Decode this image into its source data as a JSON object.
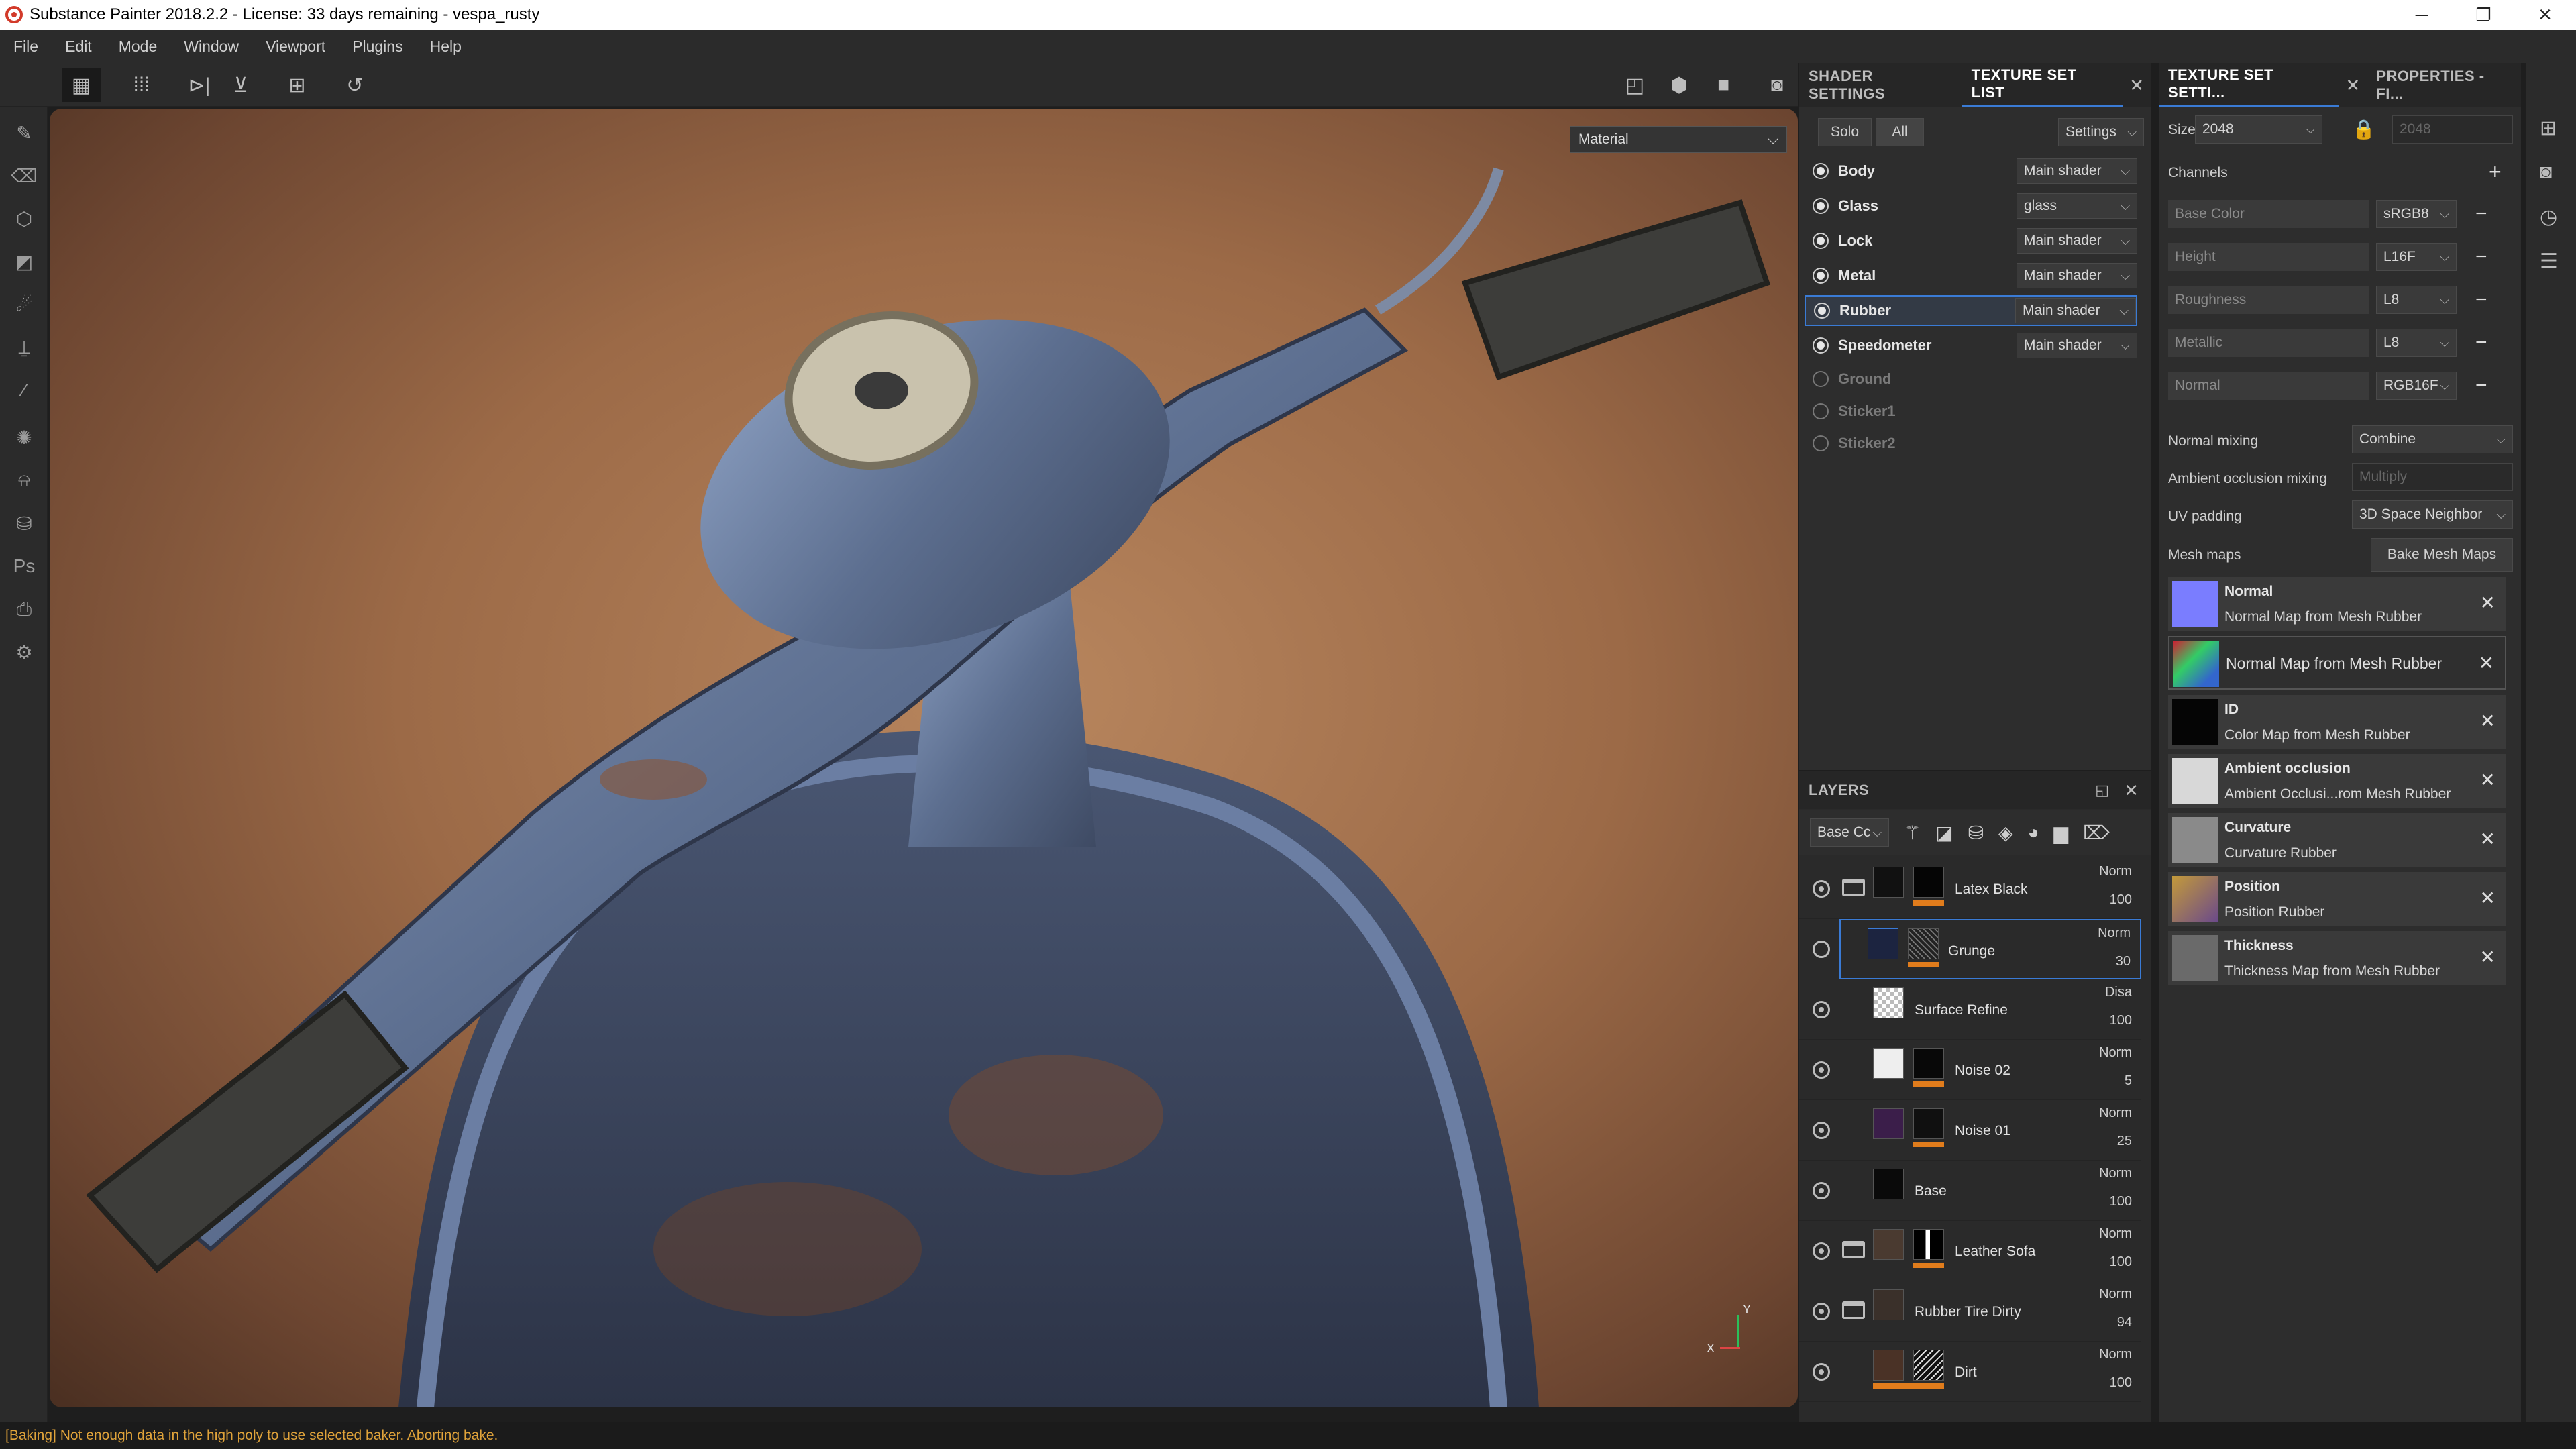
{
  "titlebar": {
    "title": "Substance Painter 2018.2.2 - License: 33 days remaining - vespa_rusty"
  },
  "menu": [
    "File",
    "Edit",
    "Mode",
    "Window",
    "Viewport",
    "Plugins",
    "Help"
  ],
  "viewport": {
    "material_dropdown": "Material",
    "axis_x": "X",
    "axis_y": "Y"
  },
  "shader_panel": {
    "tabs": [
      "SHADER SETTINGS",
      "TEXTURE SET LIST"
    ],
    "solo": "Solo",
    "all": "All",
    "settings": "Settings",
    "texture_sets": [
      {
        "name": "Body",
        "shader": "Main shader",
        "enabled": true
      },
      {
        "name": "Glass",
        "shader": "glass",
        "enabled": true
      },
      {
        "name": "Lock",
        "shader": "Main shader",
        "enabled": true
      },
      {
        "name": "Metal",
        "shader": "Main shader",
        "enabled": true
      },
      {
        "name": "Rubber",
        "shader": "Main shader",
        "enabled": true,
        "selected": true
      },
      {
        "name": "Speedometer",
        "shader": "Main shader",
        "enabled": true
      },
      {
        "name": "Ground",
        "enabled": false
      },
      {
        "name": "Sticker1",
        "enabled": false
      },
      {
        "name": "Sticker2",
        "enabled": false
      }
    ]
  },
  "layers": {
    "title": "LAYERS",
    "channel": "Base Cc",
    "items": [
      {
        "name": "Latex Black",
        "blend": "Norm",
        "opacity": "100"
      },
      {
        "name": "Grunge",
        "blend": "Norm",
        "opacity": "30"
      },
      {
        "name": "Surface Refine",
        "blend": "Disa",
        "opacity": "100"
      },
      {
        "name": "Noise 02",
        "blend": "Norm",
        "opacity": "5"
      },
      {
        "name": "Noise 01",
        "blend": "Norm",
        "opacity": "25"
      },
      {
        "name": "Base",
        "blend": "Norm",
        "opacity": "100"
      },
      {
        "name": "Leather Sofa",
        "blend": "Norm",
        "opacity": "100"
      },
      {
        "name": "Rubber Tire Dirty",
        "blend": "Norm",
        "opacity": "94"
      },
      {
        "name": "Dirt",
        "blend": "Norm",
        "opacity": "100"
      }
    ]
  },
  "texset_panel": {
    "tabs": [
      "TEXTURE SET SETTI...",
      "PROPERTIES - FI..."
    ],
    "size_label": "Size",
    "size_value": "2048",
    "size_value2": "2048",
    "channels_label": "Channels",
    "channels": [
      {
        "name": "Base Color",
        "format": "sRGB8"
      },
      {
        "name": "Height",
        "format": "L16F"
      },
      {
        "name": "Roughness",
        "format": "L8"
      },
      {
        "name": "Metallic",
        "format": "L8"
      },
      {
        "name": "Normal",
        "format": "RGB16F"
      }
    ],
    "normal_mixing_label": "Normal mixing",
    "normal_mixing": "Combine",
    "ao_mixing_label": "Ambient occlusion mixing",
    "ao_mixing": "Multiply",
    "uv_padding_label": "UV padding",
    "uv_padding": "3D Space Neighbor",
    "mesh_maps_label": "Mesh maps",
    "bake_button": "Bake Mesh Maps",
    "mesh_maps": [
      {
        "title": "Normal",
        "sub": "Normal Map from Mesh Rubber",
        "color": "#7a7dff"
      },
      {
        "title": "",
        "sub": "Normal Map from Mesh Rubber",
        "color": "#5aa07a"
      },
      {
        "title": "ID",
        "sub": "Color Map from Mesh Rubber",
        "color": "#050505"
      },
      {
        "title": "Ambient occlusion",
        "sub": "Ambient Occlusi...rom Mesh Rubber",
        "color": "#d8d8d8"
      },
      {
        "title": "Curvature",
        "sub": "Curvature Rubber",
        "color": "#8a8a8a"
      },
      {
        "title": "Position",
        "sub": "Position Rubber",
        "color": "#9c7a3a"
      },
      {
        "title": "Thickness",
        "sub": "Thickness Map from Mesh Rubber",
        "color": "#6a6a6a"
      }
    ]
  },
  "status": "[Baking] Not enough data in the high poly to use selected baker. Aborting bake."
}
